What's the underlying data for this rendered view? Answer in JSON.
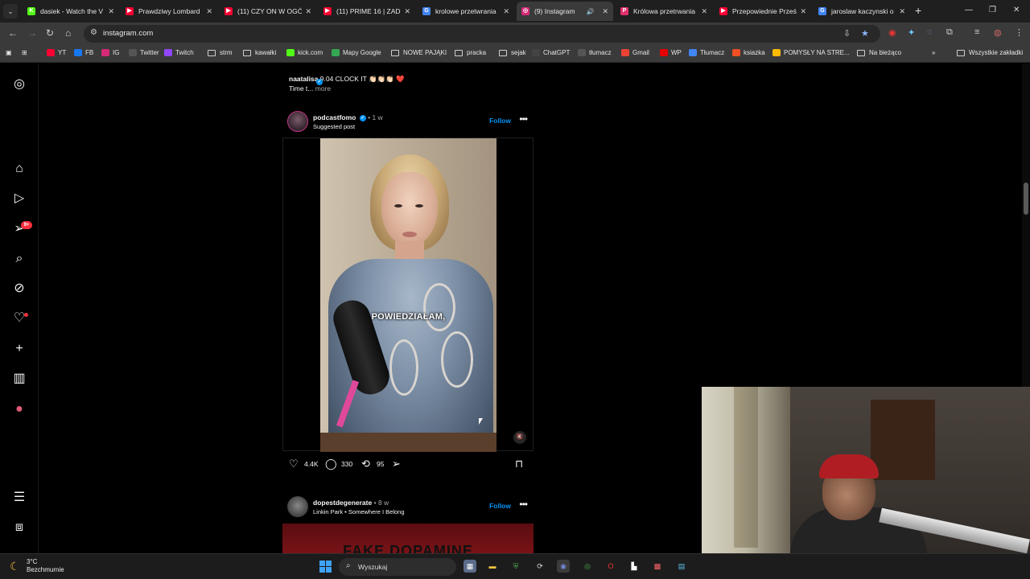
{
  "browser": {
    "tabs": [
      {
        "title": "dasiek - Watch the V",
        "favicon": "K",
        "color": "#53fc18",
        "active": false
      },
      {
        "title": "Prawdziwy Lombard",
        "favicon": "▶",
        "color": "#ff0033",
        "active": false
      },
      {
        "title": "(11) CZY ON W OGÓ",
        "favicon": "▶",
        "color": "#ff0033",
        "active": false
      },
      {
        "title": "(11) PRIME 16 | ZADY",
        "favicon": "▶",
        "color": "#ff0033",
        "active": false
      },
      {
        "title": "krolowe przetwrania",
        "favicon": "G",
        "color": "#4285f4",
        "active": false
      },
      {
        "title": "(9) Instagram",
        "favicon": "◎",
        "color": "#d62976",
        "active": true
      },
      {
        "title": "Królowa przetrwania",
        "favicon": "P",
        "color": "#e1306c",
        "active": false
      },
      {
        "title": "Przepowiednie Prześ",
        "favicon": "▶",
        "color": "#ff0033",
        "active": false
      },
      {
        "title": "jaroslaw kaczynski o",
        "favicon": "G",
        "color": "#4285f4",
        "active": false
      }
    ],
    "url": "instagram.com",
    "bookmarks": [
      {
        "label": "YT",
        "type": "site",
        "color": "#ff0033"
      },
      {
        "label": "FB",
        "type": "site",
        "color": "#1877f2"
      },
      {
        "label": "IG",
        "type": "site",
        "color": "#d62976"
      },
      {
        "label": "Twitter",
        "type": "site",
        "color": "#555555"
      },
      {
        "label": "Twitch",
        "type": "site",
        "color": "#9146ff"
      },
      {
        "label": "strm",
        "type": "folder"
      },
      {
        "label": "kawałki",
        "type": "folder"
      },
      {
        "label": "kick.com",
        "type": "site",
        "color": "#53fc18"
      },
      {
        "label": "Mapy Google",
        "type": "site",
        "color": "#34a853"
      },
      {
        "label": "NOWE PAJĄKI",
        "type": "folder"
      },
      {
        "label": "pracka",
        "type": "folder"
      },
      {
        "label": "sejak",
        "type": "folder"
      },
      {
        "label": "ChatGPT",
        "type": "site",
        "color": "#444444"
      },
      {
        "label": "tłumacz",
        "type": "site",
        "color": "#555555"
      },
      {
        "label": "Gmail",
        "type": "site",
        "color": "#ea4335"
      },
      {
        "label": "WP",
        "type": "site",
        "color": "#e60000"
      },
      {
        "label": "Tłumacz",
        "type": "site",
        "color": "#4285f4"
      },
      {
        "label": "ksiazka",
        "type": "site",
        "color": "#f25022"
      },
      {
        "label": "POMYSŁY NA STRE...",
        "type": "site",
        "color": "#ffb900"
      },
      {
        "label": "Na bieżąco",
        "type": "folder"
      }
    ],
    "all_bookmarks": "Wszystkie zakładki"
  },
  "instagram": {
    "notif_badge": "9+",
    "prev_caption": {
      "user": "naatalisa",
      "text": "9.04 CLOCK IT 👏🏻👏🏻👏🏻 ❤️",
      "more_prefix": "Time t...",
      "more": "more"
    },
    "post1": {
      "user": "podcastfomo",
      "time": "1 w",
      "subtitle": "Suggested post",
      "follow": "Follow",
      "subtitle_overlay": "POWIEDZIAŁAM,",
      "likes": "4.4K",
      "comments": "330",
      "reposts": "95"
    },
    "post2": {
      "user": "dopestdegenerate",
      "time": "8 w",
      "subtitle": "Linkin Park • Somewhere I Belong",
      "follow": "Follow",
      "media_text": "FAKE DOPAMINE"
    }
  },
  "taskbar": {
    "temperature": "3°C",
    "weather": "Bezchmurnie",
    "search_placeholder": "Wyszukaj"
  }
}
